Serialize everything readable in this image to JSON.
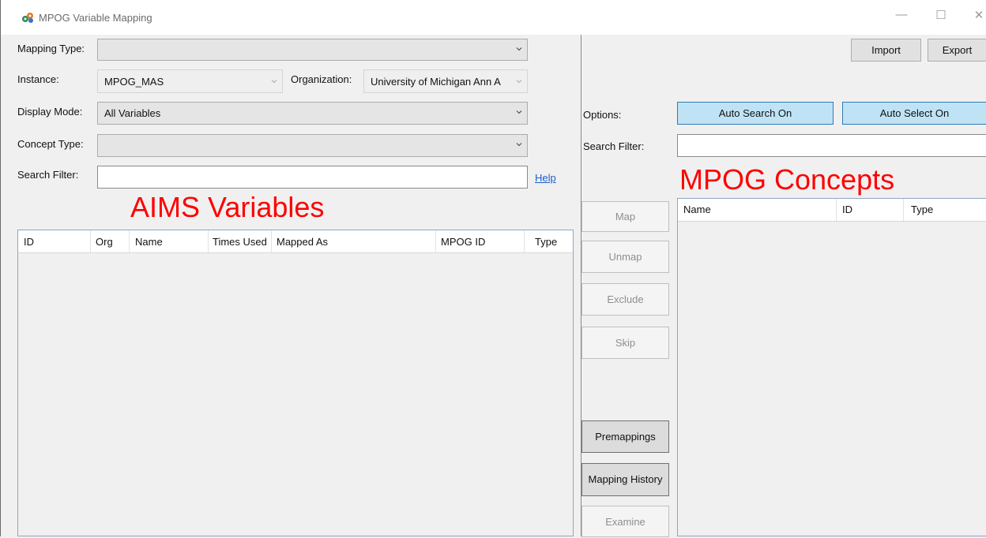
{
  "window": {
    "title": "MPOG Variable Mapping",
    "minimize": "—",
    "maximize": "☐",
    "close": "✕"
  },
  "form": {
    "mapping_type_label": "Mapping Type:",
    "mapping_type_value": "",
    "instance_label": "Instance:",
    "instance_value": "MPOG_MAS",
    "organization_label": "Organization:",
    "organization_value": "University of Michigan Ann A",
    "display_mode_label": "Display Mode:",
    "display_mode_value": "All Variables",
    "concept_type_label": "Concept Type:",
    "concept_type_value": "",
    "search_filter_label": "Search Filter:",
    "search_filter_value": "",
    "help_link": "Help"
  },
  "aims": {
    "heading": "AIMS Variables",
    "columns": [
      "ID",
      "Org",
      "Name",
      "Times Used",
      "Mapped As",
      "MPOG ID",
      "Type"
    ]
  },
  "actions": {
    "map": "Map",
    "unmap": "Unmap",
    "exclude": "Exclude",
    "skip": "Skip",
    "premappings": "Premappings",
    "mapping_history": "Mapping History",
    "examine": "Examine"
  },
  "right": {
    "import": "Import",
    "export": "Export",
    "options_label": "Options:",
    "auto_search": "Auto Search On",
    "auto_select": "Auto Select On",
    "search_filter_label": "Search Filter:",
    "search_filter_value": ""
  },
  "concepts": {
    "heading": "MPOG Concepts",
    "columns": [
      "Name",
      "ID",
      "Type"
    ]
  },
  "colors": {
    "annotation": "#ff0000",
    "toggle_on": "#bfe3f5",
    "link": "#1a5fc9"
  }
}
